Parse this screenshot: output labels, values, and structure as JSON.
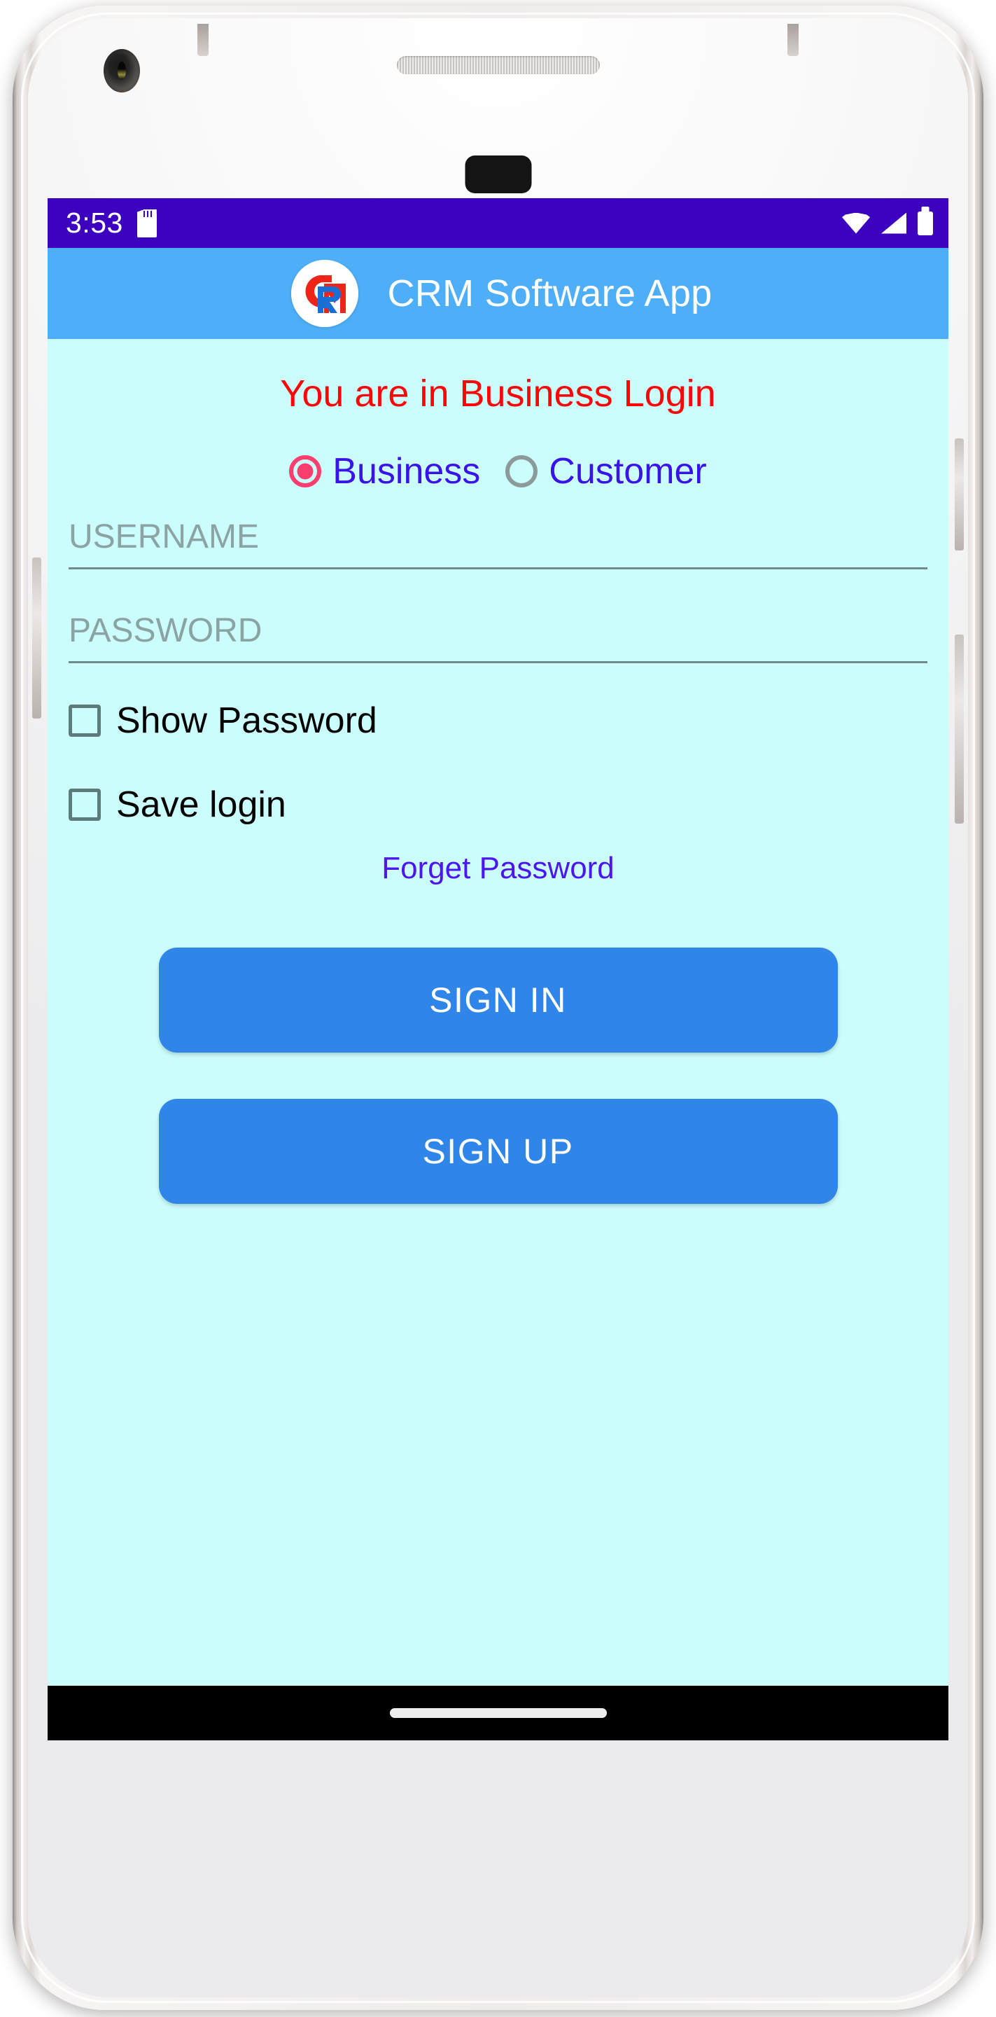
{
  "device": {
    "hardware": {
      "front_camera": "front-camera",
      "speaker": "earpiece-speaker",
      "sensor": "proximity-sensor"
    }
  },
  "status_bar": {
    "time": "3:53",
    "icons": [
      "sd-card-icon",
      "wifi-icon",
      "cellular-signal-icon",
      "battery-icon"
    ],
    "background": "#3c02c0"
  },
  "app_bar": {
    "title": "CRM Software App",
    "logo_name": "crm-logo",
    "logo_letters": [
      "C",
      "R",
      "M"
    ],
    "background": "#4eaef8",
    "title_color": "#ffffff"
  },
  "screen": {
    "background": "#ccfdfd"
  },
  "main": {
    "notice": "You are in Business Login",
    "notice_color": "#fb0606",
    "account_type": {
      "selected": "Business",
      "options": [
        {
          "label": "Business",
          "selected": true
        },
        {
          "label": "Customer",
          "selected": false
        }
      ],
      "selected_color": "#fb3e6e",
      "unselected_color": "#8c9a9a",
      "label_color": "#3913e8"
    },
    "fields": [
      {
        "name": "username",
        "placeholder": "USERNAME",
        "value": ""
      },
      {
        "name": "password",
        "placeholder": "PASSWORD",
        "value": ""
      }
    ],
    "checkboxes": [
      {
        "label": "Show Password",
        "checked": false
      },
      {
        "label": "Save login",
        "checked": false
      }
    ],
    "forget_password": "Forget Password",
    "forget_password_color": "#4b16ef",
    "buttons": [
      {
        "label": "SIGN IN",
        "color": "#2f86e8"
      },
      {
        "label": "SIGN UP",
        "color": "#2f86e8"
      }
    ]
  },
  "nav_bar": {
    "gesture_pill": "home-gesture-pill",
    "background": "#000000"
  }
}
